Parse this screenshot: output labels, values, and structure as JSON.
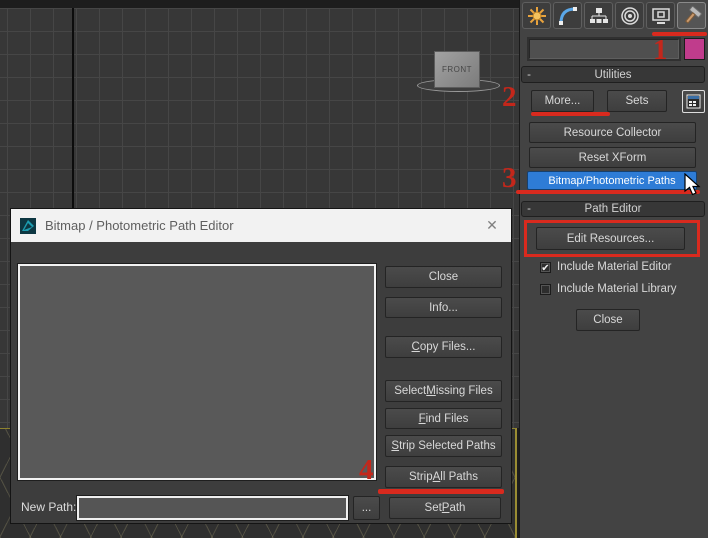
{
  "colors": {
    "annotation_red": "#d92a1e",
    "selection_blue": "#2e7cd6",
    "object_color_swatch": "#c03c8c",
    "viewport_active_border": "#9a8d33"
  },
  "viewport": {
    "front_box_label": "FRONT"
  },
  "panel": {
    "tabs": [
      {
        "icon": "create-icon"
      },
      {
        "icon": "modify-icon"
      },
      {
        "icon": "hierarchy-icon"
      },
      {
        "icon": "motion-icon"
      },
      {
        "icon": "display-icon"
      },
      {
        "icon": "utilities-icon"
      }
    ],
    "object_name_field": {
      "value": "",
      "placeholder": ""
    },
    "utilities_rollout": {
      "title": "Utilities",
      "collapse_glyph": "-",
      "more_button": "More...",
      "sets_button": "Sets",
      "utility_buttons": [
        "Resource Collector",
        "Reset XForm",
        "Bitmap/Photometric Paths"
      ]
    },
    "path_editor_rollout": {
      "title": "Path Editor",
      "collapse_glyph": "-",
      "edit_resources_button": "Edit Resources...",
      "checkboxes": [
        {
          "label": "Include Material Editor",
          "checked": true,
          "glyph": "✔"
        },
        {
          "label": "Include Material Library",
          "checked": false,
          "glyph": ""
        }
      ],
      "close_button": "Close"
    }
  },
  "dialog": {
    "title": "Bitmap / Photometric Path Editor",
    "close_glyph": "✕",
    "buttons": [
      {
        "label": "Close",
        "mnemonic": ""
      },
      {
        "label": "Info...",
        "mnemonic": ""
      },
      {
        "label": "Copy Files...",
        "mnemonic": "C"
      },
      {
        "label": "Select Missing Files",
        "mnemonic": "M"
      },
      {
        "label": "Find Files",
        "mnemonic": "F"
      },
      {
        "label": "Strip Selected Paths",
        "mnemonic": "S"
      },
      {
        "label": "Strip All Paths",
        "mnemonic": "A"
      },
      {
        "label": "Set Path",
        "mnemonic": "P"
      }
    ],
    "new_path_label": "New Path:",
    "new_path_value": "",
    "browse_button": "..."
  },
  "annotations": {
    "step1": "1",
    "step2": "2",
    "step3": "3",
    "step4": "4"
  }
}
